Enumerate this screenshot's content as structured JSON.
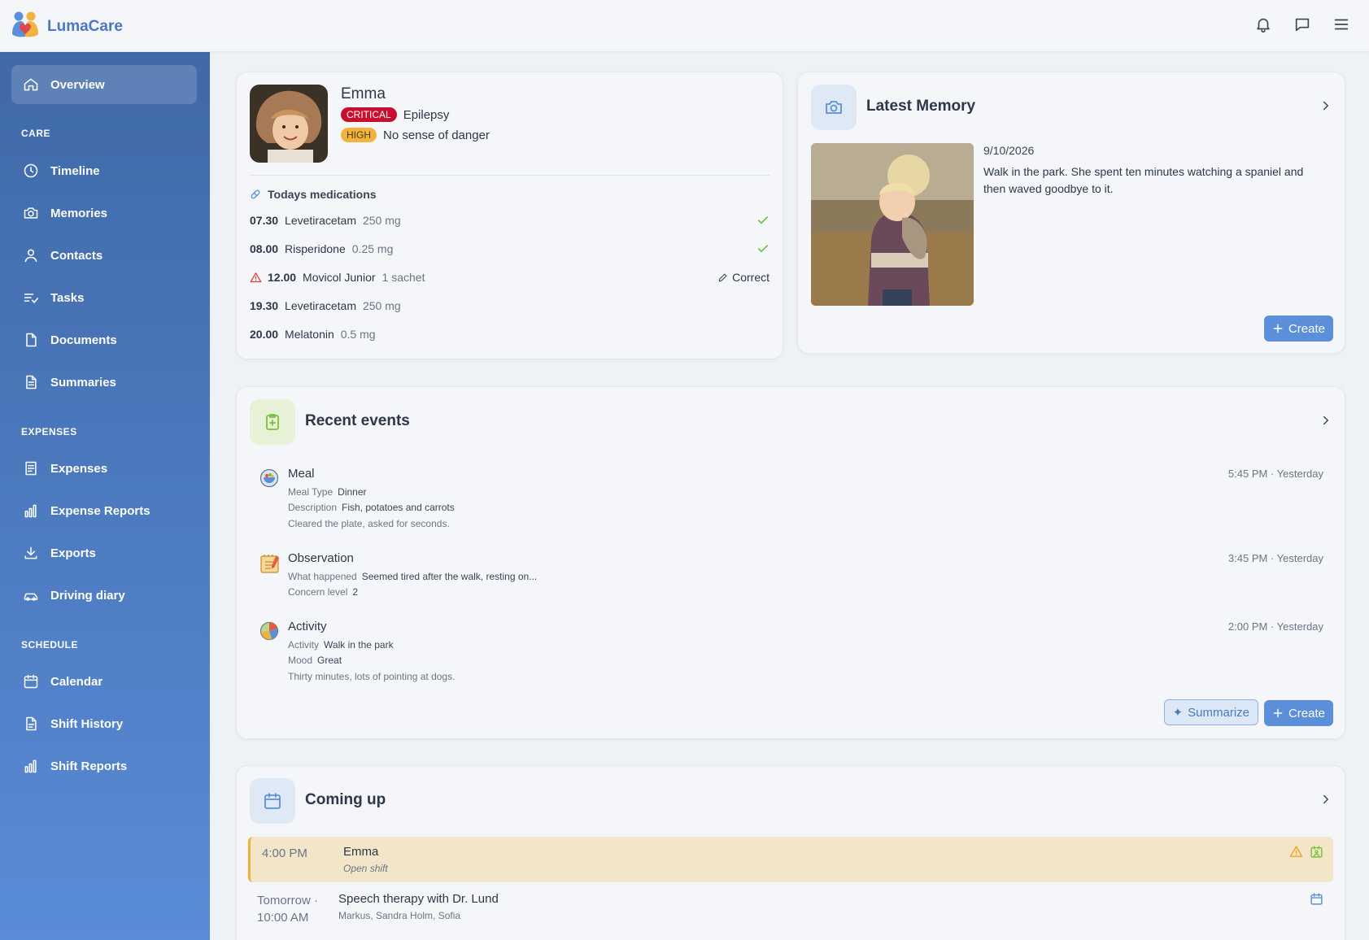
{
  "app": {
    "name": "LumaCare"
  },
  "topbar": {
    "icons": [
      "bell-icon",
      "chat-icon",
      "menu-icon"
    ]
  },
  "sidebar": {
    "overview": "Overview",
    "sections": {
      "care": "CARE",
      "expenses": "EXPENSES",
      "schedule": "SCHEDULE"
    },
    "care_items": [
      "Timeline",
      "Memories",
      "Contacts",
      "Tasks",
      "Documents",
      "Summaries"
    ],
    "expense_items": [
      "Expenses",
      "Expense Reports",
      "Exports",
      "Driving diary"
    ],
    "schedule_items": [
      "Calendar",
      "Shift History",
      "Shift Reports"
    ]
  },
  "profile": {
    "name": "Emma",
    "conditions": [
      {
        "level": "CRITICAL",
        "label": "Epilepsy",
        "color": "#c8102e"
      },
      {
        "level": "HIGH",
        "label": "No sense of danger",
        "color": "#f2b33d"
      }
    ],
    "medications_title": "Todays medications",
    "medications": [
      {
        "time": "07.30",
        "name": "Levetiracetam",
        "dose": "250 mg",
        "status": "done"
      },
      {
        "time": "08.00",
        "name": "Risperidone",
        "dose": "0.25 mg",
        "status": "done"
      },
      {
        "time": "12.00",
        "name": "Movicol Junior",
        "dose": "1 sachet",
        "status": "warning",
        "action": "Correct"
      },
      {
        "time": "19.30",
        "name": "Levetiracetam",
        "dose": "250 mg",
        "status": "pending"
      },
      {
        "time": "20.00",
        "name": "Melatonin",
        "dose": "0.5 mg",
        "status": "pending"
      }
    ]
  },
  "memory": {
    "title": "Latest Memory",
    "date": "9/10/2026",
    "text": "Walk in the park. She spent ten minutes watching a spaniel and then waved goodbye to it.",
    "create_label": "Create"
  },
  "events": {
    "title": "Recent events",
    "items": [
      {
        "title": "Meal",
        "time": "5:45 PM · Yesterday",
        "fields": [
          {
            "k": "Meal Type",
            "v": "Dinner"
          },
          {
            "k": "Description",
            "v": "Fish, potatoes and carrots"
          }
        ],
        "note": "Cleared the plate, asked for seconds."
      },
      {
        "title": "Observation",
        "time": "3:45 PM · Yesterday",
        "fields": [
          {
            "k": "What happened",
            "v": "Seemed tired after the walk, resting on..."
          },
          {
            "k": "Concern level",
            "v": "2"
          }
        ],
        "note": ""
      },
      {
        "title": "Activity",
        "time": "2:00 PM · Yesterday",
        "fields": [
          {
            "k": "Activity",
            "v": "Walk in the park"
          },
          {
            "k": "Mood",
            "v": "Great"
          }
        ],
        "note": "Thirty minutes, lots of pointing at dogs."
      }
    ],
    "summarize_label": "Summarize",
    "create_label": "Create"
  },
  "coming_up": {
    "title": "Coming up",
    "items": [
      {
        "time": "4:00 PM",
        "title": "Emma",
        "subtitle": "Open shift"
      },
      {
        "time_day": "Tomorrow ·",
        "time": "10:00 AM",
        "title": "Speech therapy with Dr. Lund",
        "subtitle": "Markus, Sandra Holm, Sofia"
      }
    ]
  },
  "colors": {
    "sidebar_top": "#3f69a8",
    "sidebar_bottom": "#5a8bd6",
    "accent": "#5b8fd9",
    "critical": "#c8102e",
    "high": "#f2b33d",
    "success": "#6cc04a",
    "warning": "#e04040"
  }
}
